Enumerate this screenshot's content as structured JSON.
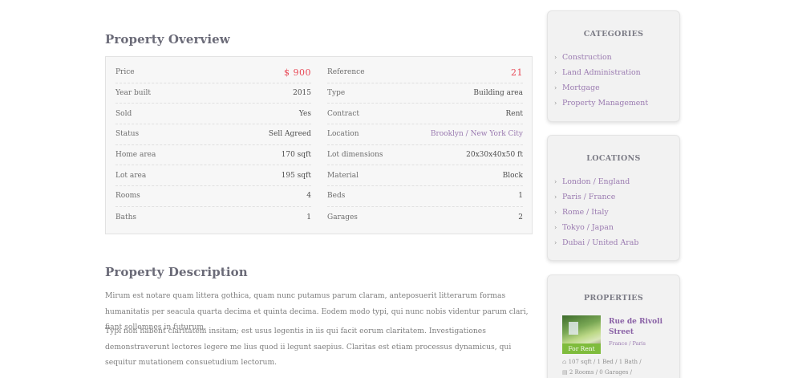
{
  "overview": {
    "title": "Property Overview",
    "left": [
      {
        "label": "Price",
        "value": "$ 900"
      },
      {
        "label": "Year built",
        "value": "2015"
      },
      {
        "label": "Sold",
        "value": "Yes"
      },
      {
        "label": "Status",
        "value": "Sell Agreed"
      },
      {
        "label": "Home area",
        "value": "170 sqft"
      },
      {
        "label": "Lot area",
        "value": "195 sqft"
      },
      {
        "label": "Rooms",
        "value": "4"
      },
      {
        "label": "Baths",
        "value": "1"
      }
    ],
    "right": [
      {
        "label": "Reference",
        "value": "21"
      },
      {
        "label": "Type",
        "value": "Building area"
      },
      {
        "label": "Contract",
        "value": "Rent"
      },
      {
        "label": "Location",
        "value": "Brooklyn / New York City"
      },
      {
        "label": "Lot dimensions",
        "value": "20x30x40x50 ft"
      },
      {
        "label": "Material",
        "value": "Block"
      },
      {
        "label": "Beds",
        "value": "1"
      },
      {
        "label": "Garages",
        "value": "2"
      }
    ]
  },
  "description": {
    "title": "Property Description",
    "para1": "Mirum est notare quam littera gothica, quam nunc putamus parum claram, anteposuerit litterarum formas humanitatis per seacula quarta decima et quinta decima. Eodem modo typi, qui nunc nobis videntur parum clari, fiant sollemnes in futurum.",
    "para2": "Typi non habent claritatem insitam; est usus legentis in iis qui facit eorum claritatem. Investigationes demonstraverunt lectores legere me lius quod ii legunt saepius. Claritas est etiam processus dynamicus, qui sequitur mutationem consuetudium lectorum."
  },
  "sidebar": {
    "categories": {
      "title": "CATEGORIES",
      "items": [
        "Construction",
        "Land Administration",
        "Mortgage",
        "Property Management"
      ]
    },
    "locations": {
      "title": "LOCATIONS",
      "items": [
        "London / England",
        "Paris / France",
        "Rome / Italy",
        "Tokyo / Japan",
        "Dubai / United Arab"
      ]
    },
    "properties": {
      "title": "PROPERTIES",
      "item": {
        "badge": "For Rent",
        "name": "Rue de Rivoli Street",
        "location": "France / Paris",
        "meta_line1": "107 sqft / 1 Bed / 1 Bath /",
        "meta_line2": "2 Rooms / 0 Garages /"
      }
    }
  },
  "colors": {
    "accent_purple": "#9a7ab0",
    "price_red": "#e84856",
    "badge_green": "#7fbc3c"
  }
}
